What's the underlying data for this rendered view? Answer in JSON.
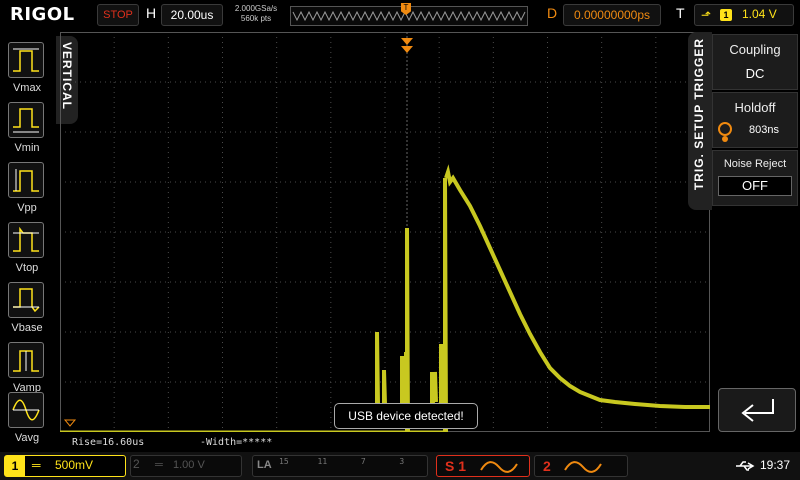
{
  "header": {
    "logo": "RIGOL",
    "run_state": "STOP",
    "h_label": "H",
    "h_scale": "20.00us",
    "sample_rate": "2.000GSa/s",
    "points": "560k pts",
    "delay_label": "D",
    "delay": "0.00000000ps",
    "trig_label": "T",
    "trig_channel": "1",
    "trig_level": "1.04 V"
  },
  "left_panel": {
    "tab_label": "VERTICAL",
    "measurements": [
      "Vmax",
      "Vmin",
      "Vpp",
      "Vtop",
      "Vbase",
      "Vamp",
      "Vavg"
    ]
  },
  "right_panel": {
    "tab_label": "TRIG. SETUP TRIGGER",
    "coupling_label": "Coupling",
    "coupling_value": "DC",
    "holdoff_label": "Holdoff",
    "holdoff_value": "803ns",
    "noise_label": "Noise Reject",
    "noise_value": "OFF"
  },
  "notice": "USB device detected!",
  "measure_line": {
    "rise": "Rise=16.60us",
    "width": "-Width=*****"
  },
  "bottom": {
    "ch1_num": "1",
    "ch1_coupling": "═",
    "ch1_scale": "500mV",
    "ch2_num": "2",
    "ch2_scale": "1.00 V",
    "la_label": "LA",
    "la_row1": "15      11       7       3",
    "la_row2": "              ",
    "s1_label": "S 1",
    "s2_label": "2",
    "clock": "19:37"
  },
  "colors": {
    "ch1": "#ffe31a",
    "trace": "#c8c820",
    "trigger": "#f08a10",
    "stop": "#e0301c"
  }
}
